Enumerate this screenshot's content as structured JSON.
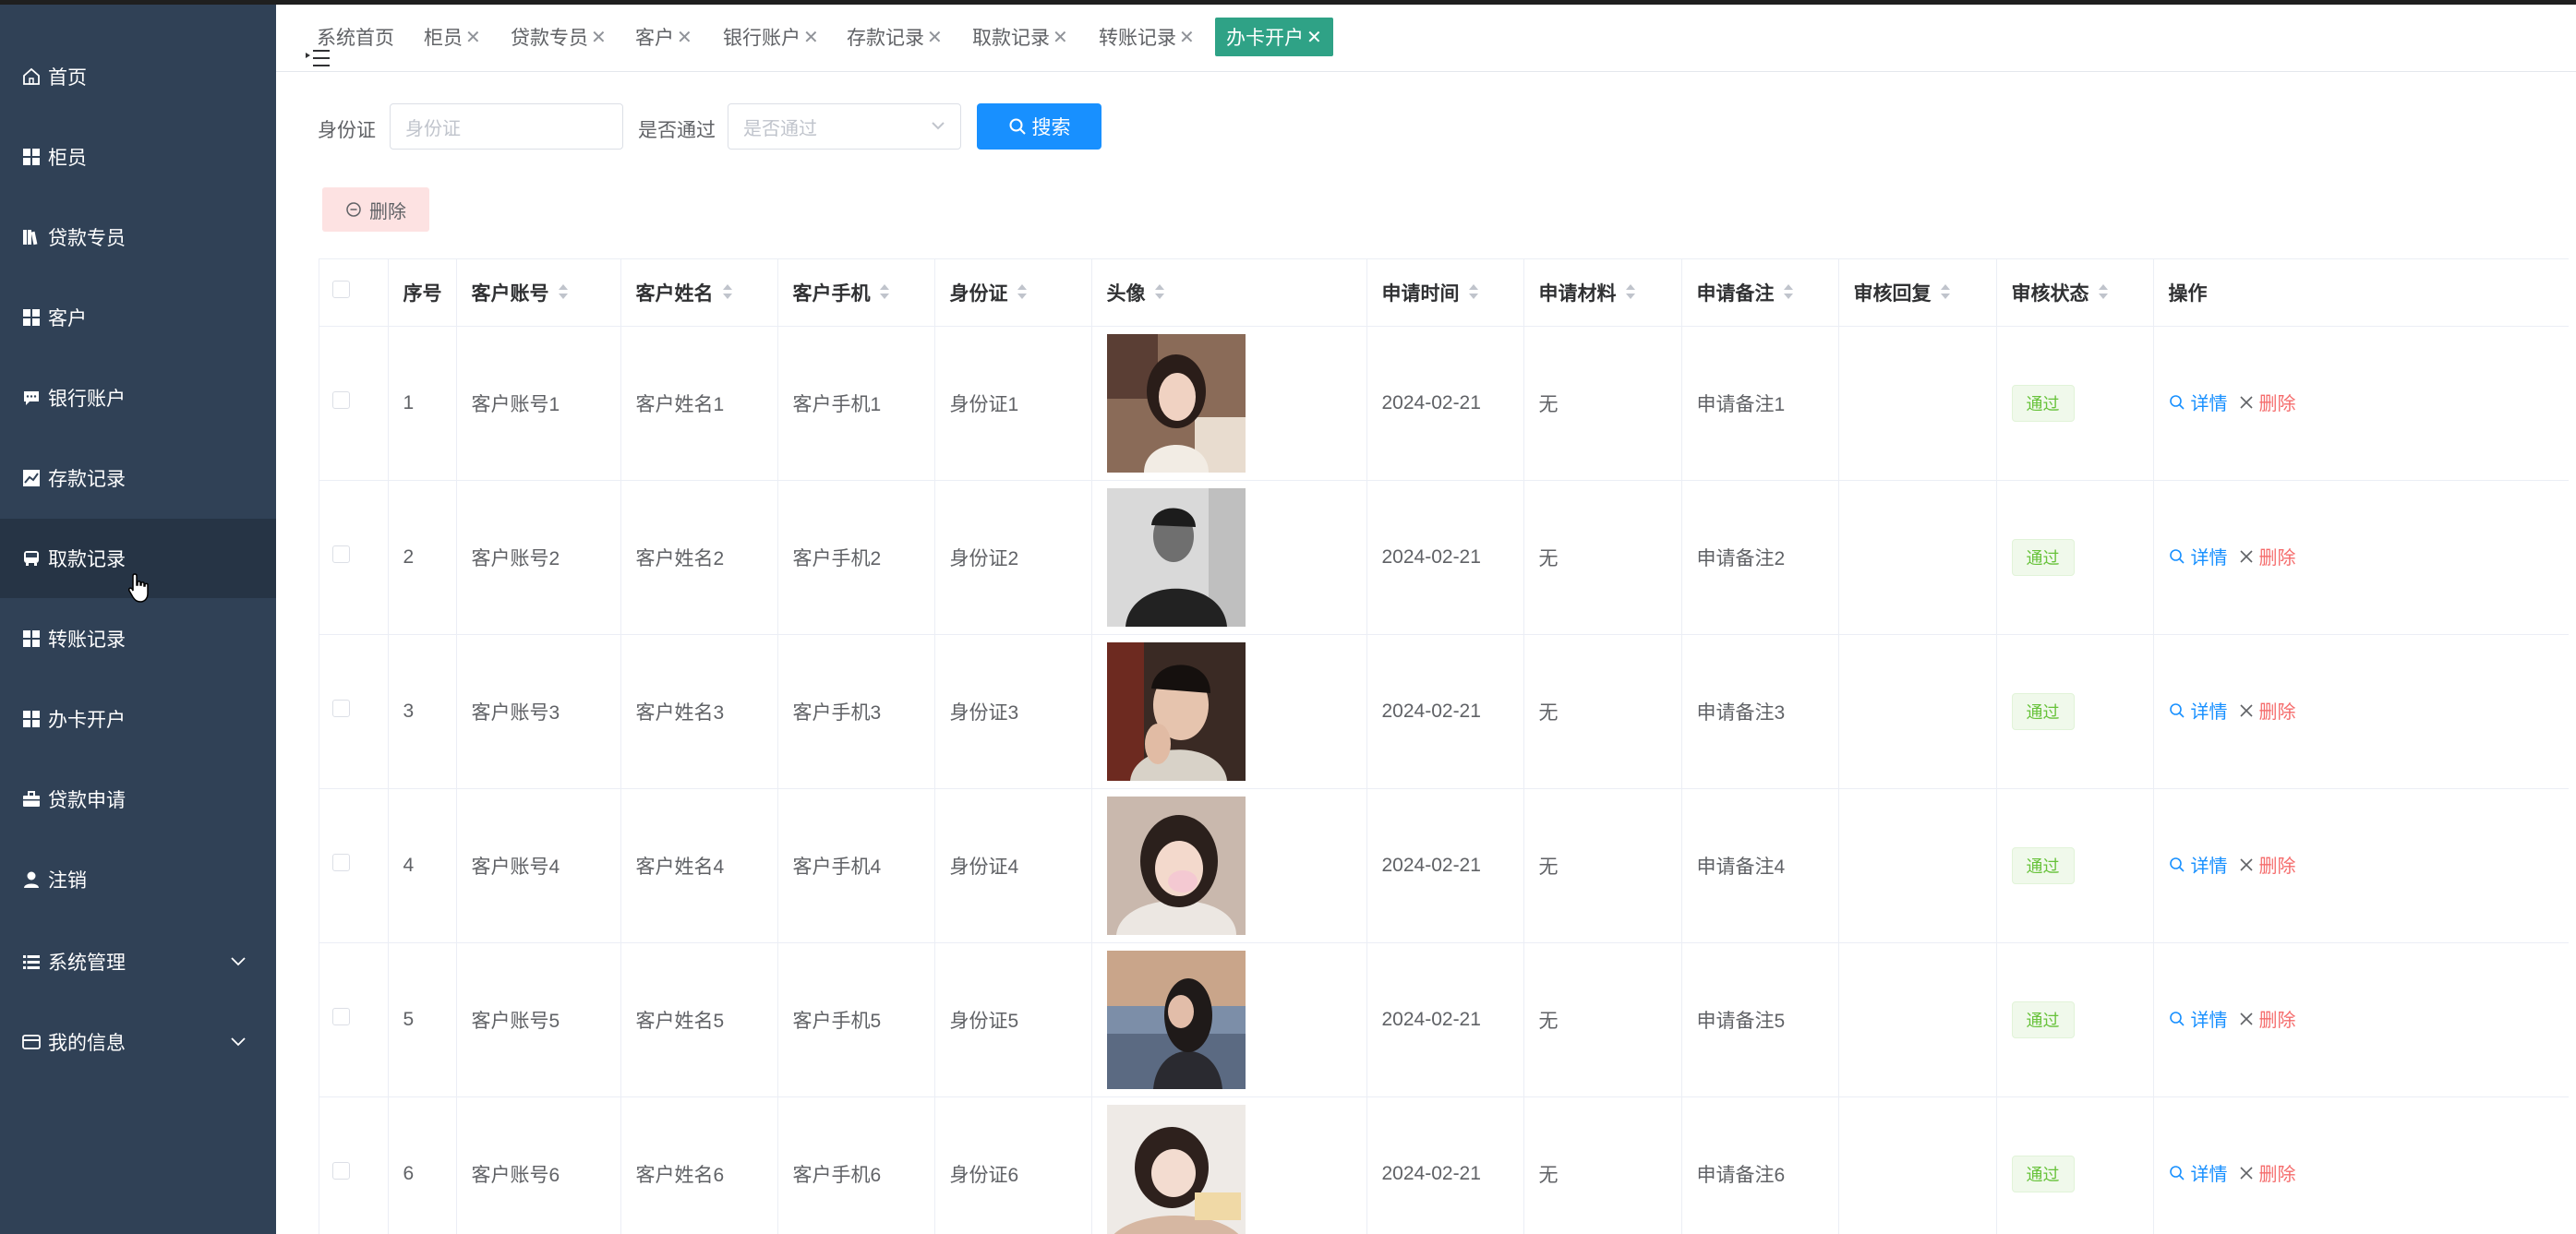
{
  "sidebar": {
    "items": [
      {
        "label": "首页",
        "icon": "home-icon"
      },
      {
        "label": "柜员",
        "icon": "grid-icon"
      },
      {
        "label": "贷款专员",
        "icon": "books-icon"
      },
      {
        "label": "客户",
        "icon": "grid-icon"
      },
      {
        "label": "银行账户",
        "icon": "chat-icon"
      },
      {
        "label": "存款记录",
        "icon": "chart-icon"
      },
      {
        "label": "取款记录",
        "icon": "bus-icon"
      },
      {
        "label": "转账记录",
        "icon": "grid-icon"
      },
      {
        "label": "办卡开户",
        "icon": "grid-icon"
      },
      {
        "label": "贷款申请",
        "icon": "briefcase-icon"
      },
      {
        "label": "注销",
        "icon": "user-icon"
      },
      {
        "label": "系统管理",
        "icon": "list-icon"
      },
      {
        "label": "我的信息",
        "icon": "card-icon"
      }
    ],
    "active": "取款记录",
    "colors": {
      "bg": "#304156",
      "active_bg": "#263445"
    }
  },
  "tabs": [
    {
      "label": "系统首页",
      "closable": false
    },
    {
      "label": "柜员",
      "closable": true
    },
    {
      "label": "贷款专员",
      "closable": true
    },
    {
      "label": "客户",
      "closable": true
    },
    {
      "label": "银行账户",
      "closable": true
    },
    {
      "label": "存款记录",
      "closable": true
    },
    {
      "label": "取款记录",
      "closable": true
    },
    {
      "label": "转账记录",
      "closable": true
    },
    {
      "label": "办卡开户",
      "closable": true,
      "active": true
    }
  ],
  "tab_close_glyph": "✕",
  "search": {
    "id_label": "身份证",
    "id_placeholder": "身份证",
    "pass_label": "是否通过",
    "pass_placeholder": "是否通过",
    "button_label": "搜索"
  },
  "toolbar": {
    "delete_label": "删除"
  },
  "table": {
    "headers": [
      "序号",
      "客户账号",
      "客户姓名",
      "客户手机",
      "身份证",
      "头像",
      "申请时间",
      "申请材料",
      "申请备注",
      "审核回复",
      "审核状态",
      "操作"
    ],
    "rows": [
      {
        "index": "1",
        "account": "客户账号1",
        "name": "客户姓名1",
        "phone": "客户手机1",
        "id_card": "身份证1",
        "date": "2024-02-21",
        "material": "无",
        "note": "申请备注1",
        "reply": "",
        "status": "通过"
      },
      {
        "index": "2",
        "account": "客户账号2",
        "name": "客户姓名2",
        "phone": "客户手机2",
        "id_card": "身份证2",
        "date": "2024-02-21",
        "material": "无",
        "note": "申请备注2",
        "reply": "",
        "status": "通过"
      },
      {
        "index": "3",
        "account": "客户账号3",
        "name": "客户姓名3",
        "phone": "客户手机3",
        "id_card": "身份证3",
        "date": "2024-02-21",
        "material": "无",
        "note": "申请备注3",
        "reply": "",
        "status": "通过"
      },
      {
        "index": "4",
        "account": "客户账号4",
        "name": "客户姓名4",
        "phone": "客户手机4",
        "id_card": "身份证4",
        "date": "2024-02-21",
        "material": "无",
        "note": "申请备注4",
        "reply": "",
        "status": "通过"
      },
      {
        "index": "5",
        "account": "客户账号5",
        "name": "客户姓名5",
        "phone": "客户手机5",
        "id_card": "身份证5",
        "date": "2024-02-21",
        "material": "无",
        "note": "申请备注5",
        "reply": "",
        "status": "通过"
      },
      {
        "index": "6",
        "account": "客户账号6",
        "name": "客户姓名6",
        "phone": "客户手机6",
        "id_card": "身份证6",
        "date": "2024-02-21",
        "material": "无",
        "note": "申请备注6",
        "reply": "",
        "status": "通过"
      }
    ],
    "actions": {
      "detail": "详情",
      "delete": "删除"
    }
  },
  "colors": {
    "primary": "#1890ff",
    "active_tab": "#2fa286",
    "success_text": "#67c23a",
    "danger_text": "#f56c6c",
    "delete_button_bg": "#fde2e2"
  }
}
